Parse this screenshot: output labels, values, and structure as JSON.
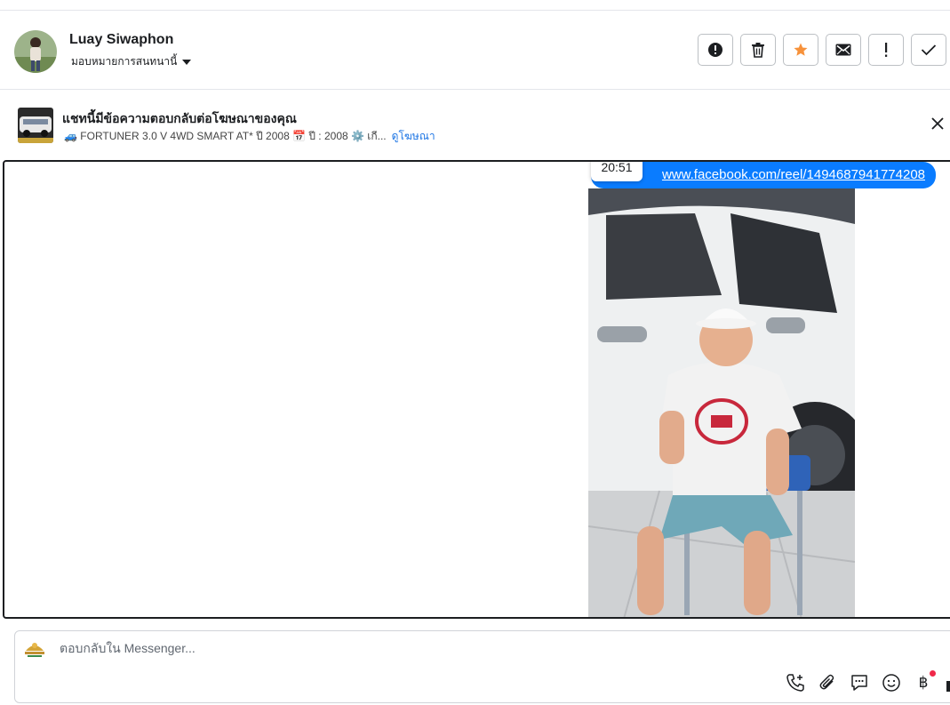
{
  "header": {
    "contact_name": "Luay Siwaphon",
    "assign_label": "มอบหมายการสนทนานี้",
    "actions": [
      "report-icon",
      "trash-icon",
      "star-icon",
      "envelope-icon",
      "important-icon",
      "check-icon"
    ],
    "star_color": "#f7923b"
  },
  "ad_context": {
    "title": "แชทนี้มีข้อความตอบกลับต่อโฆษณาของคุณ",
    "meta": "🚙 FORTUNER 3.0 V 4WD SMART AT* ปี 2008 📅 ปี : 2008 ⚙️ เกี...",
    "link": "ดูโฆษณา"
  },
  "conversation": {
    "message_text": "www.facebook.com/reel/1494687941774208",
    "tooltip_time": "20:51",
    "bubble_color": "#0a7cff"
  },
  "composer": {
    "placeholder": "ตอบกลับใน Messenger...",
    "tools": [
      "phone-add-icon",
      "paperclip-icon",
      "chat-bubble-icon",
      "emoji-icon",
      "baht-icon",
      "like-icon"
    ]
  }
}
